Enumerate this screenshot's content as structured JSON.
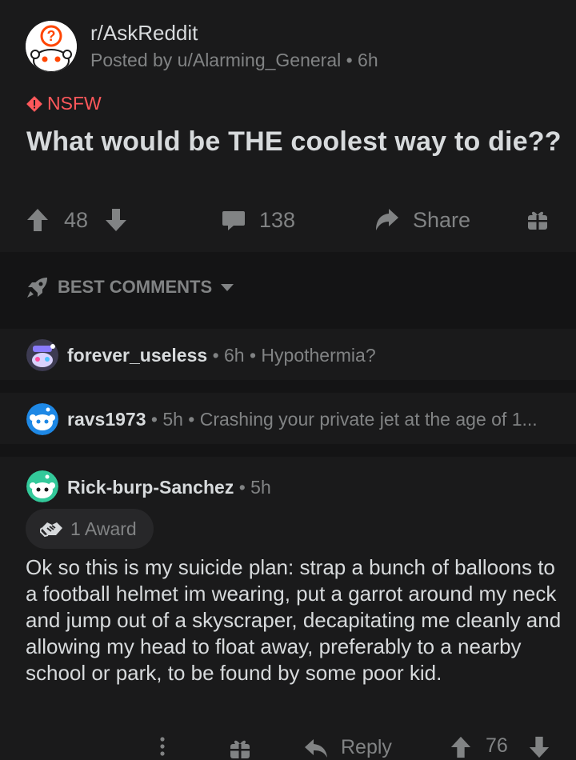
{
  "post": {
    "subreddit": "r/AskReddit",
    "posted_by": "Posted by u/Alarming_General • 6h",
    "nsfw_label": "NSFW",
    "title": "What would be THE coolest way to die??",
    "upvotes": "48",
    "comments": "138",
    "share_label": "Share"
  },
  "sort": {
    "label": "BEST COMMENTS"
  },
  "comments": [
    {
      "user": "forever_useless",
      "meta": " • 6h • Hypothermia?"
    },
    {
      "user": "ravs1973",
      "meta": " • 5h • Crashing your private jet at the age of 1..."
    },
    {
      "user": "Rick-burp-Sanchez",
      "meta": " • 5h",
      "award": "1 Award",
      "body": "Ok so this is my suicide plan: strap a bunch of balloons to a football helmet im wearing, put a garrot around my neck and jump out of a skyscraper, decapitating me cleanly and allowing my head to float away, preferably to a nearby school or park, to be found by some poor kid.",
      "reply_label": "Reply",
      "score": "76"
    }
  ],
  "colors": {
    "background": "#1a1a1b",
    "band": "#141415",
    "nsfw": "#ff585b",
    "muted": "#818384",
    "text": "#d7dadc"
  },
  "icons": [
    "snoo-question-icon",
    "nsfw-diamond-icon",
    "upvote-icon",
    "downvote-icon",
    "comment-icon",
    "share-icon",
    "gift-icon",
    "rocket-icon",
    "caret-down-icon",
    "handshake-award-icon",
    "more-icon",
    "reply-icon"
  ]
}
